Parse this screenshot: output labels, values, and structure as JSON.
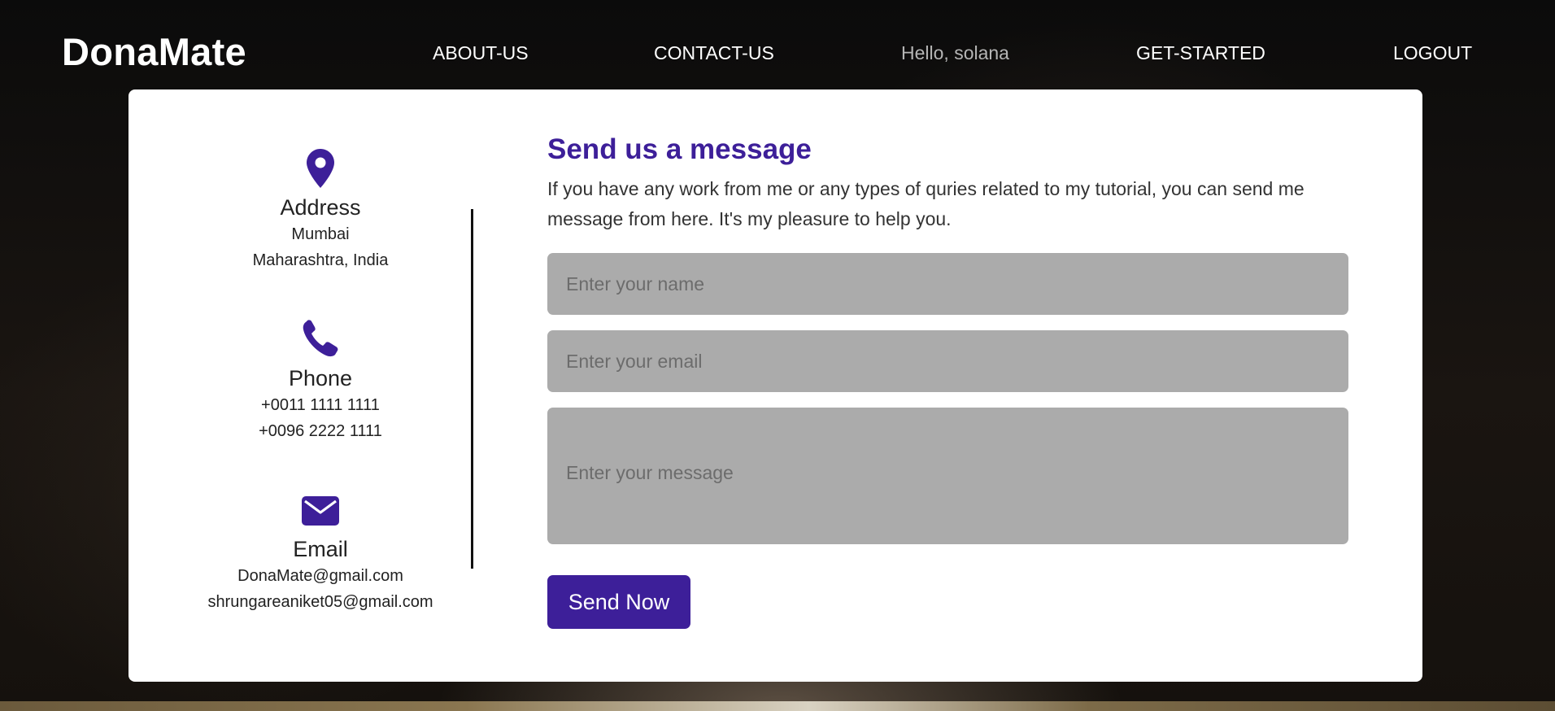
{
  "navbar": {
    "brand": "DonaMate",
    "links": {
      "about": "ABOUT-US",
      "contact": "CONTACT-US",
      "greeting": "Hello, solana",
      "get_started": "GET-STARTED",
      "logout": "LOGOUT"
    }
  },
  "contact_info": {
    "address": {
      "icon": "map-pin-icon",
      "title": "Address",
      "lines": [
        "Mumbai",
        "Maharashtra, India"
      ]
    },
    "phone": {
      "icon": "phone-icon",
      "title": "Phone",
      "lines": [
        "+0011 1111 1111",
        "+0096 2222 1111"
      ]
    },
    "email": {
      "icon": "envelope-icon",
      "title": "Email",
      "lines": [
        "DonaMate@gmail.com",
        "shrungareaniket05@gmail.com"
      ]
    }
  },
  "form": {
    "title": "Send us a message",
    "description": "If you have any work from me or any types of quries related to my tutorial, you can send me message from here. It's my pleasure to help you.",
    "name_placeholder": "Enter your name",
    "email_placeholder": "Enter your email",
    "message_placeholder": "Enter your message",
    "submit_label": "Send Now"
  },
  "colors": {
    "accent": "#3d1f99",
    "field_bg": "#ababab",
    "card_bg": "#ffffff"
  }
}
